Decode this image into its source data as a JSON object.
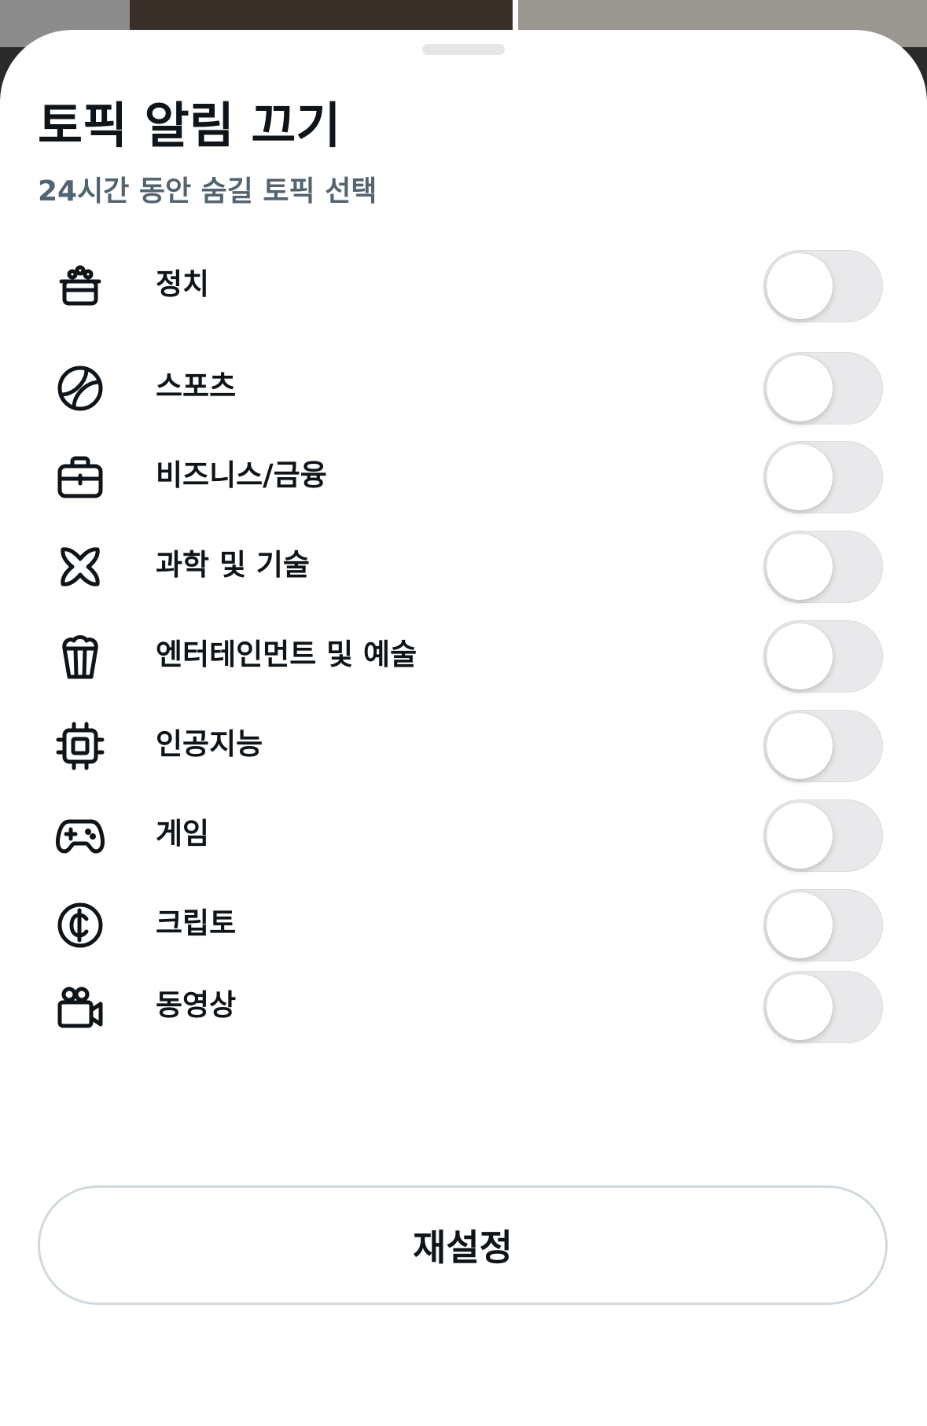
{
  "sheet": {
    "title": "토픽 알림 끄기",
    "subtitle": "24시간 동안 숨길 토픽 선택"
  },
  "topics": [
    {
      "label": "정치",
      "icon": "politics-podium-icon",
      "enabled": false
    },
    {
      "label": "스포츠",
      "icon": "sports-ball-icon",
      "enabled": false
    },
    {
      "label": "비즈니스/금융",
      "icon": "briefcase-icon",
      "enabled": false
    },
    {
      "label": "과학 및 기술",
      "icon": "science-atom-icon",
      "enabled": false
    },
    {
      "label": "엔터테인먼트 및 예술",
      "icon": "popcorn-icon",
      "enabled": false
    },
    {
      "label": "인공지능",
      "icon": "chip-icon",
      "enabled": false
    },
    {
      "label": "게임",
      "icon": "gamepad-icon",
      "enabled": false
    },
    {
      "label": "크립토",
      "icon": "crypto-coin-icon",
      "enabled": false
    },
    {
      "label": "동영상",
      "icon": "video-camera-icon",
      "enabled": false
    }
  ],
  "reset_button": {
    "label": "재설정"
  },
  "colors": {
    "text_primary": "#0f1419",
    "text_secondary": "#536471",
    "toggle_off_track": "#e9e9eb",
    "button_border": "#cfd9de"
  }
}
